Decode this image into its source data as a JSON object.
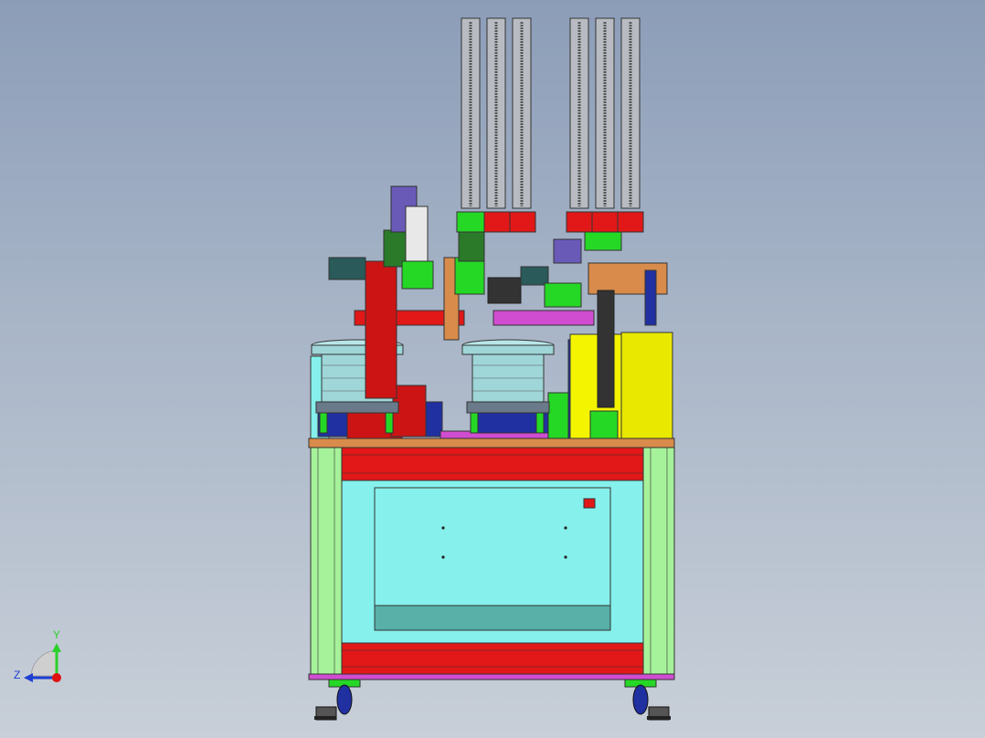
{
  "viewport": {
    "background_top": "#8c9db8",
    "background_bottom": "#c8cfd8"
  },
  "triad": {
    "y_label": "Y",
    "z_label": "Z",
    "y_color": "#2bd02b",
    "z_color": "#1f3fd0",
    "origin_color": "#e01010"
  },
  "colors": {
    "frame_green": "#a6f29a",
    "frame_blue_inner": "#4a66d6",
    "panel_cyan": "#86f0ec",
    "panel_teal": "#58b0a8",
    "rail_red": "#e21818",
    "plate_orange": "#d88b4a",
    "base_magenta": "#d04cd0",
    "bowl_steel": "#9fd6d8",
    "cabinet_yellow": "#f4f400",
    "cylinder_grey": "#b8bcc2",
    "dark_green": "#2a7a2a",
    "bright_green": "#25d825",
    "navy": "#2030a0"
  }
}
